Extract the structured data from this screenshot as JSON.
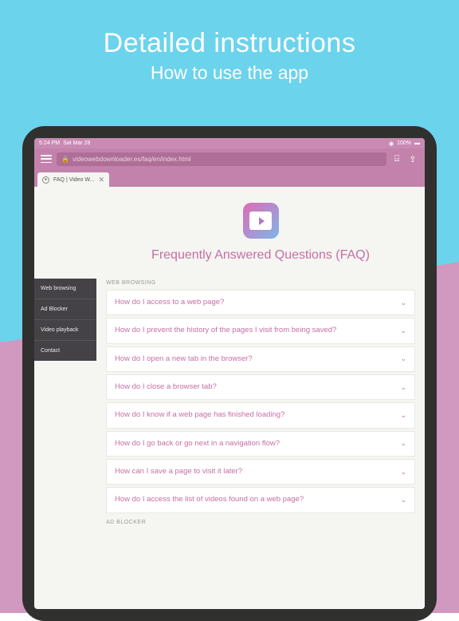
{
  "promo": {
    "title": "Detailed instructions",
    "subtitle": "How to use the app"
  },
  "status": {
    "time": "5:24 PM",
    "date": "Sat Mar 28",
    "battery": "100%"
  },
  "url": "videowebdownloader.es/faq/en/index.html",
  "tab": {
    "label": "FAQ | Video W..."
  },
  "page_title": "Frequently Answered Questions (FAQ)",
  "sidebar": {
    "items": [
      {
        "label": "Web browsing"
      },
      {
        "label": "Ad Blocker"
      },
      {
        "label": "Video playback"
      },
      {
        "label": "Contact"
      }
    ]
  },
  "sections": {
    "web_browsing": {
      "heading": "WEB BROWSING",
      "items": [
        {
          "q": "How do I access to a web page?"
        },
        {
          "q": "How do I prevent the history of the pages I visit from being saved?"
        },
        {
          "q": "How do I open a new tab in the browser?"
        },
        {
          "q": "How do I close a browser tab?"
        },
        {
          "q": "How do I know if a web page has finished loading?"
        },
        {
          "q": "How do I go back or go next in a navigation flow?"
        },
        {
          "q": "How can I save a page to visit it later?"
        },
        {
          "q": "How do I access the list of videos found on a web page?"
        }
      ]
    },
    "ad_blocker": {
      "heading": "AD BLOCKER"
    }
  }
}
